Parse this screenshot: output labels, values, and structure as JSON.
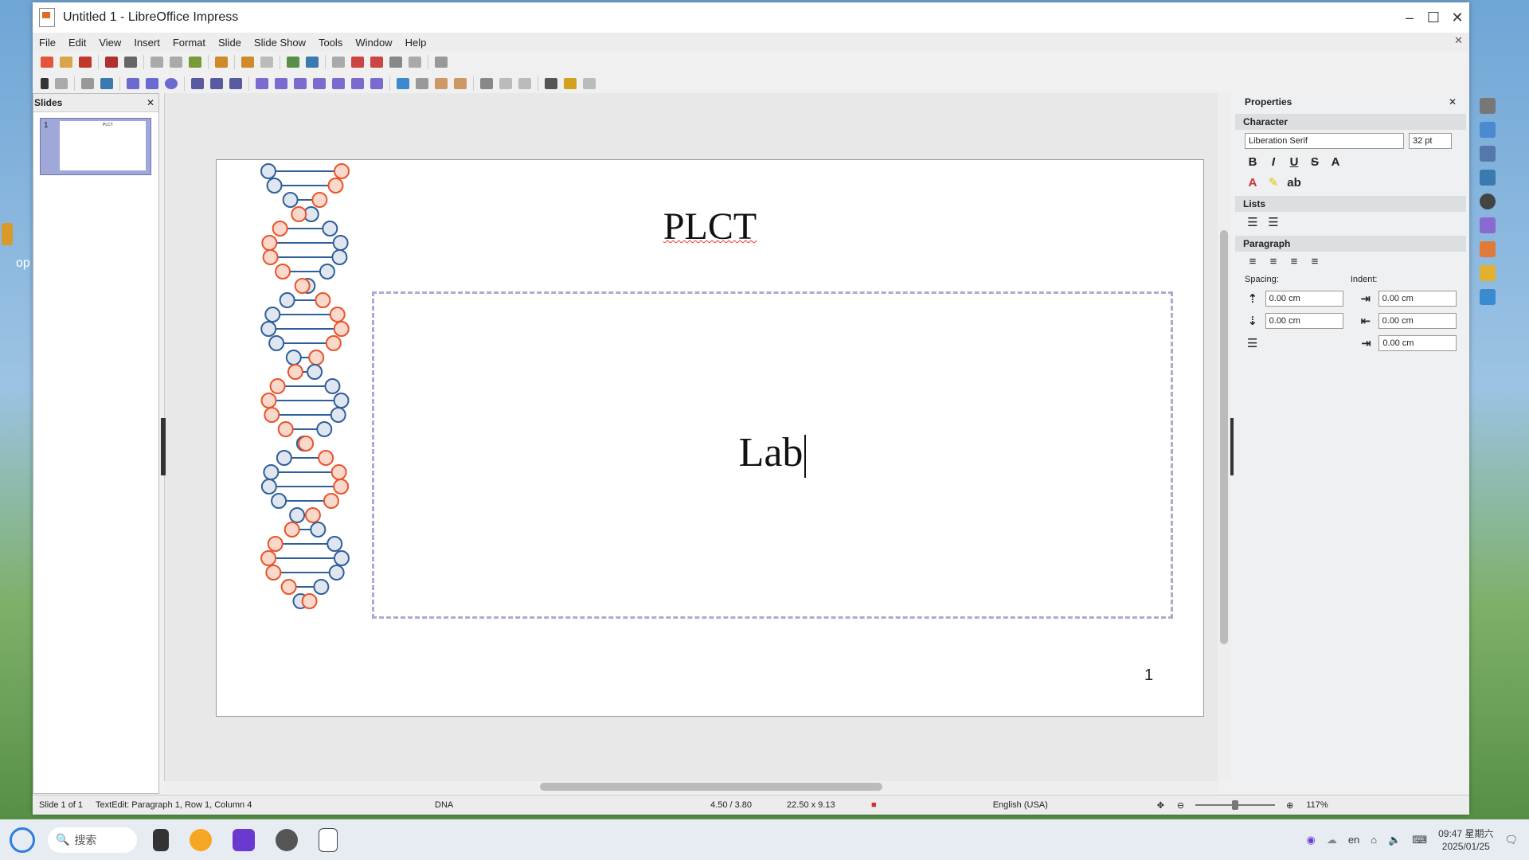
{
  "window": {
    "title": "Untitled 1 - LibreOffice Impress",
    "minimize": "–",
    "maximize": "☐",
    "close": "✕",
    "close_doc": "✕"
  },
  "menu": [
    "File",
    "Edit",
    "View",
    "Insert",
    "Format",
    "Slide",
    "Slide Show",
    "Tools",
    "Window",
    "Help"
  ],
  "slides_pane": {
    "title": "Slides",
    "close": "✕",
    "thumb_number": "1",
    "thumb_title": "PLCT"
  },
  "slide": {
    "title": "PLCT",
    "body_text": "Lab",
    "page_number": "1"
  },
  "properties": {
    "title": "Properties",
    "close": "✕",
    "character": {
      "label": "Character",
      "font_name": "Liberation Serif",
      "font_size": "32 pt"
    },
    "lists": {
      "label": "Lists"
    },
    "paragraph": {
      "label": "Paragraph",
      "spacing_label": "Spacing:",
      "indent_label": "Indent:",
      "spacing_above": "0.00 cm",
      "spacing_below": "0.00 cm",
      "indent_before": "0.00 cm",
      "indent_after": "0.00 cm",
      "indent_first": "0.00 cm"
    }
  },
  "status": {
    "slide": "Slide 1 of 1",
    "edit": "TextEdit: Paragraph 1, Row 1, Column 4",
    "layout": "DNA",
    "position": "4.50 / 3.80",
    "size": "22.50 x 9.13",
    "language": "English (USA)",
    "zoom": "117%"
  },
  "taskbar": {
    "search": "搜索",
    "time": "09:47 星期六",
    "date": "2025/01/25",
    "lang": "en"
  },
  "desktop": {
    "label": "op"
  },
  "colors": {
    "dna_blue": "#2f5f9a",
    "dna_red": "#e8542a",
    "dna_blue_fill": "#dfe6f0",
    "dna_red_fill": "#fbd8cc"
  }
}
